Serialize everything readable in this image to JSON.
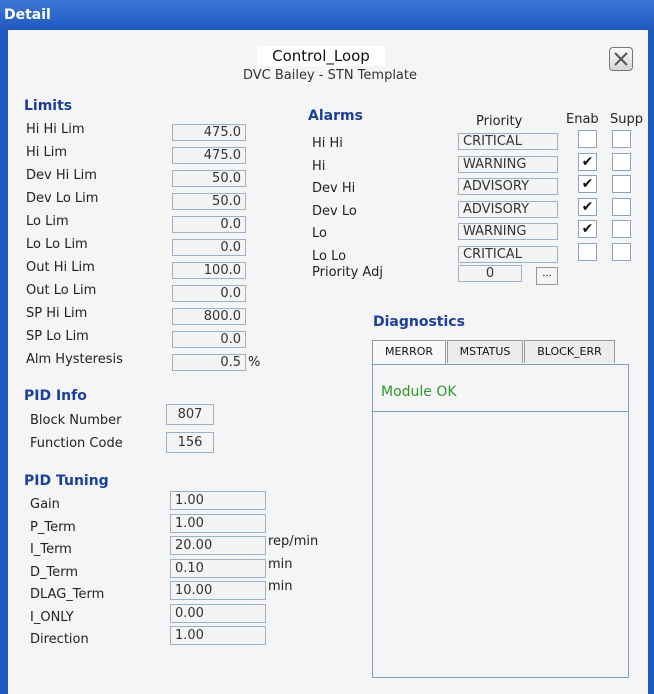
{
  "window": {
    "title": "Detail"
  },
  "header": {
    "name": "Control_Loop",
    "subtitle": "DVC Bailey - STN Template"
  },
  "limits": {
    "heading": "Limits",
    "rows": [
      {
        "label": "Hi Hi Lim",
        "value": "475.0"
      },
      {
        "label": "Hi Lim",
        "value": "475.0"
      },
      {
        "label": "Dev Hi Lim",
        "value": "50.0"
      },
      {
        "label": "Dev Lo Lim",
        "value": "50.0"
      },
      {
        "label": "Lo Lim",
        "value": "0.0"
      },
      {
        "label": "Lo Lo Lim",
        "value": "0.0"
      },
      {
        "label": "Out Hi Lim",
        "value": "100.0"
      },
      {
        "label": "Out Lo Lim",
        "value": "0.0"
      },
      {
        "label": "SP Hi Lim",
        "value": "800.0"
      },
      {
        "label": "SP Lo Lim",
        "value": "0.0"
      },
      {
        "label": "Alm Hysteresis",
        "value": "0.5",
        "unit": "%"
      }
    ]
  },
  "pid_info": {
    "heading": "PID Info",
    "rows": [
      {
        "label": "Block Number",
        "value": "807"
      },
      {
        "label": "Function Code",
        "value": "156"
      }
    ]
  },
  "pid_tuning": {
    "heading": "PID Tuning",
    "rows": [
      {
        "label": "Gain",
        "value": "1.00",
        "unit": ""
      },
      {
        "label": "P_Term",
        "value": "1.00",
        "unit": ""
      },
      {
        "label": "I_Term",
        "value": "20.00",
        "unit": "rep/min"
      },
      {
        "label": "D_Term",
        "value": "0.10",
        "unit": "min"
      },
      {
        "label": "DLAG_Term",
        "value": "10.00",
        "unit": "min"
      },
      {
        "label": "I_ONLY",
        "value": "0.00",
        "unit": ""
      },
      {
        "label": "Direction",
        "value": "1.00",
        "unit": ""
      }
    ]
  },
  "alarms": {
    "heading": "Alarms",
    "col_priority": "Priority",
    "col_enab": "Enab",
    "col_supp": "Supp",
    "rows": [
      {
        "label": "Hi Hi",
        "priority": "CRITICAL",
        "enab": "",
        "supp": ""
      },
      {
        "label": "Hi",
        "priority": "WARNING",
        "enab": "✔",
        "supp": ""
      },
      {
        "label": "Dev Hi",
        "priority": "ADVISORY",
        "enab": "✔",
        "supp": ""
      },
      {
        "label": "Dev Lo",
        "priority": "ADVISORY",
        "enab": "✔",
        "supp": ""
      },
      {
        "label": "Lo",
        "priority": "WARNING",
        "enab": "✔",
        "supp": ""
      },
      {
        "label": "Lo Lo",
        "priority": "CRITICAL",
        "enab": "",
        "supp": ""
      }
    ],
    "priority_adj_label": "Priority Adj",
    "priority_adj_value": "0",
    "browse_label": "..."
  },
  "diagnostics": {
    "heading": "Diagnostics",
    "tabs": [
      "MERROR",
      "MSTATUS",
      "BLOCK_ERR"
    ],
    "message": "Module OK"
  }
}
